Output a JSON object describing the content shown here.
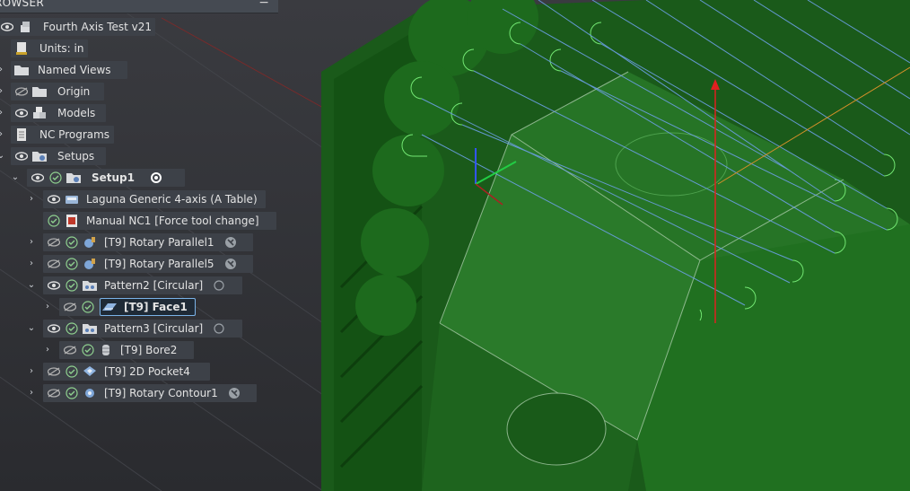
{
  "browser": {
    "title": "ROWSER",
    "collapse": "−"
  },
  "tree": [
    {
      "id": "root",
      "label": "Fourth Axis Test v21"
    },
    {
      "id": "units",
      "label": "Units: in"
    },
    {
      "id": "named_views",
      "label": "Named Views"
    },
    {
      "id": "origin",
      "label": "Origin"
    },
    {
      "id": "models",
      "label": "Models"
    },
    {
      "id": "nc_programs",
      "label": "NC Programs"
    },
    {
      "id": "setups",
      "label": "Setups"
    },
    {
      "id": "setup1",
      "label": "Setup1"
    },
    {
      "id": "laguna",
      "label": "Laguna Generic 4-axis (A Table)"
    },
    {
      "id": "manual_nc1",
      "label": "Manual NC1 [Force tool change]"
    },
    {
      "id": "rotary_parallel1",
      "label": "[T9] Rotary Parallel1"
    },
    {
      "id": "rotary_parallel5",
      "label": "[T9] Rotary Parallel5"
    },
    {
      "id": "pattern2",
      "label": "Pattern2 [Circular]"
    },
    {
      "id": "face1",
      "label": "[T9] Face1"
    },
    {
      "id": "pattern3",
      "label": "Pattern3 [Circular]"
    },
    {
      "id": "bore2",
      "label": "[T9] Bore2"
    },
    {
      "id": "pocket4",
      "label": "[T9] 2D Pocket4"
    },
    {
      "id": "rotary_contour1",
      "label": "[T9] Rotary Contour1"
    }
  ],
  "colors": {
    "part_green": "#1f6b1f",
    "toolpath_blue": "#5b8fd6",
    "toolpath_green": "#6ee06e",
    "axis_red": "#e02020",
    "tool_orange": "#c98a2c",
    "selection": "#7ab3e8"
  }
}
